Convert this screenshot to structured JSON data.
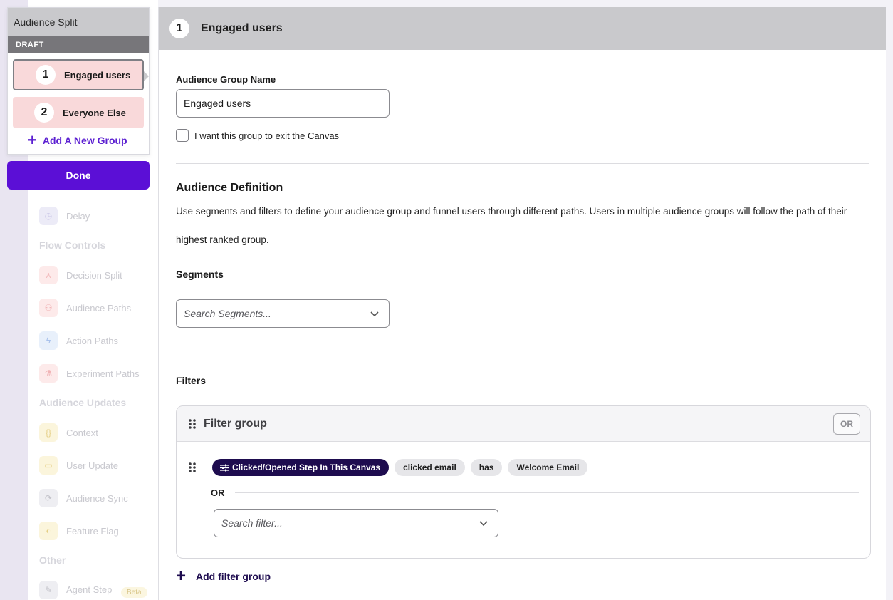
{
  "split_panel": {
    "title": "Audience Split",
    "status": "DRAFT",
    "groups": [
      {
        "number": "1",
        "label": "Engaged users"
      },
      {
        "number": "2",
        "label": "Everyone Else"
      }
    ],
    "add_group_label": "Add A New Group",
    "done_label": "Done"
  },
  "background_panel": {
    "items": [
      {
        "label": "Delay",
        "icon": "clock-icon",
        "color": "#ecebf7"
      },
      {
        "label": "Decision Split",
        "icon": "split-icon",
        "color": "#fdeaea"
      },
      {
        "label": "Audience Paths",
        "icon": "people-icon",
        "color": "#fdeaea"
      },
      {
        "label": "Action Paths",
        "icon": "lightning-icon",
        "color": "#e8f0fb"
      },
      {
        "label": "Experiment Paths",
        "icon": "flask-icon",
        "color": "#fdeaea"
      },
      {
        "label": "Context",
        "icon": "braces-icon",
        "color": "#fbf5dc"
      },
      {
        "label": "User Update",
        "icon": "card-icon",
        "color": "#fbf5dc"
      },
      {
        "label": "Audience Sync",
        "icon": "sync-icon",
        "color": "#eeeef2"
      },
      {
        "label": "Feature Flag",
        "icon": "toggle-icon",
        "color": "#fbf5dc"
      },
      {
        "label": "Agent Step",
        "icon": "wand-icon",
        "color": "#eeeef2"
      }
    ],
    "sections": [
      "Flow Controls",
      "Audience Updates",
      "Other"
    ],
    "beta_badge": "Beta"
  },
  "main": {
    "header": {
      "number": "1",
      "title": "Engaged users"
    },
    "group_name_label": "Audience Group Name",
    "group_name_value": "Engaged users",
    "exit_checkbox_label": "I want this group to exit the Canvas",
    "definition_title": "Audience Definition",
    "definition_text": "Use segments and filters to define your audience group and funnel users through different paths. Users in multiple audience groups will follow the path of their highest ranked group.",
    "segments_label": "Segments",
    "segments_placeholder": "Search Segments...",
    "filters_label": "Filters",
    "filter_group": {
      "title": "Filter group",
      "operator_badge": "OR",
      "filter_pills": {
        "main": "Clicked/Opened Step In This Canvas",
        "action": "clicked email",
        "comparator": "has",
        "value": "Welcome Email"
      },
      "or_label": "OR",
      "search_placeholder": "Search filter..."
    },
    "add_filter_group_label": "Add filter group"
  },
  "colors": {
    "accent": "#5b0fd6",
    "dark_pill": "#1e0c4f",
    "group_pink": "#f9d9da",
    "header_gray": "#c9c9cc"
  }
}
